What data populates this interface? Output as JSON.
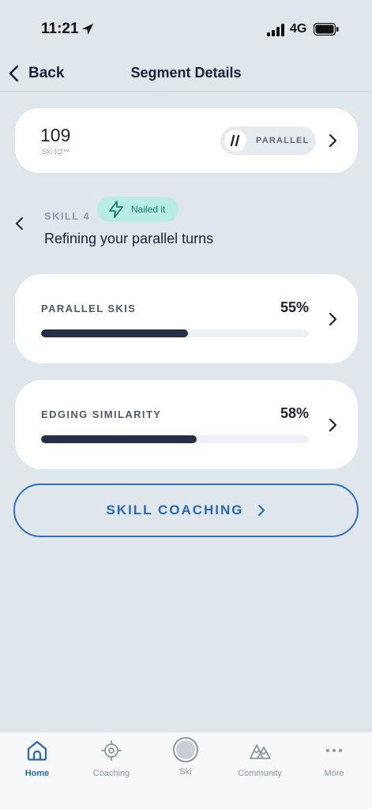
{
  "status_bar": {
    "time": "11:21",
    "network": "4G"
  },
  "nav": {
    "back_label": "Back",
    "title": "Segment Details"
  },
  "score_card": {
    "value": "109",
    "label": "Ski:IQ™",
    "level": "PARALLEL"
  },
  "skill": {
    "number": "SKILL 4",
    "badge": "Nailed it",
    "title": "Refining your parallel turns"
  },
  "metrics": [
    {
      "label": "PARALLEL SKIS",
      "value": "55%",
      "progress": 0.55
    },
    {
      "label": "EDGING SIMILARITY",
      "value": "58%",
      "progress": 0.58
    }
  ],
  "coaching_button": {
    "label": "SKILL COACHING"
  },
  "tabs": [
    {
      "label": "Home",
      "icon": "home-icon",
      "active": true
    },
    {
      "label": "Coaching",
      "icon": "target-icon",
      "active": false
    },
    {
      "label": "Ski",
      "icon": "ski-record-icon",
      "active": false
    },
    {
      "label": "Community",
      "icon": "mountain-icon",
      "active": false
    },
    {
      "label": "More",
      "icon": "more-dots-icon",
      "active": false
    }
  ],
  "colors": {
    "accent": "#2767b4",
    "badge_bg": "#b9ece4",
    "progress_fill": "#262f48",
    "background": "#dfe6ec"
  }
}
